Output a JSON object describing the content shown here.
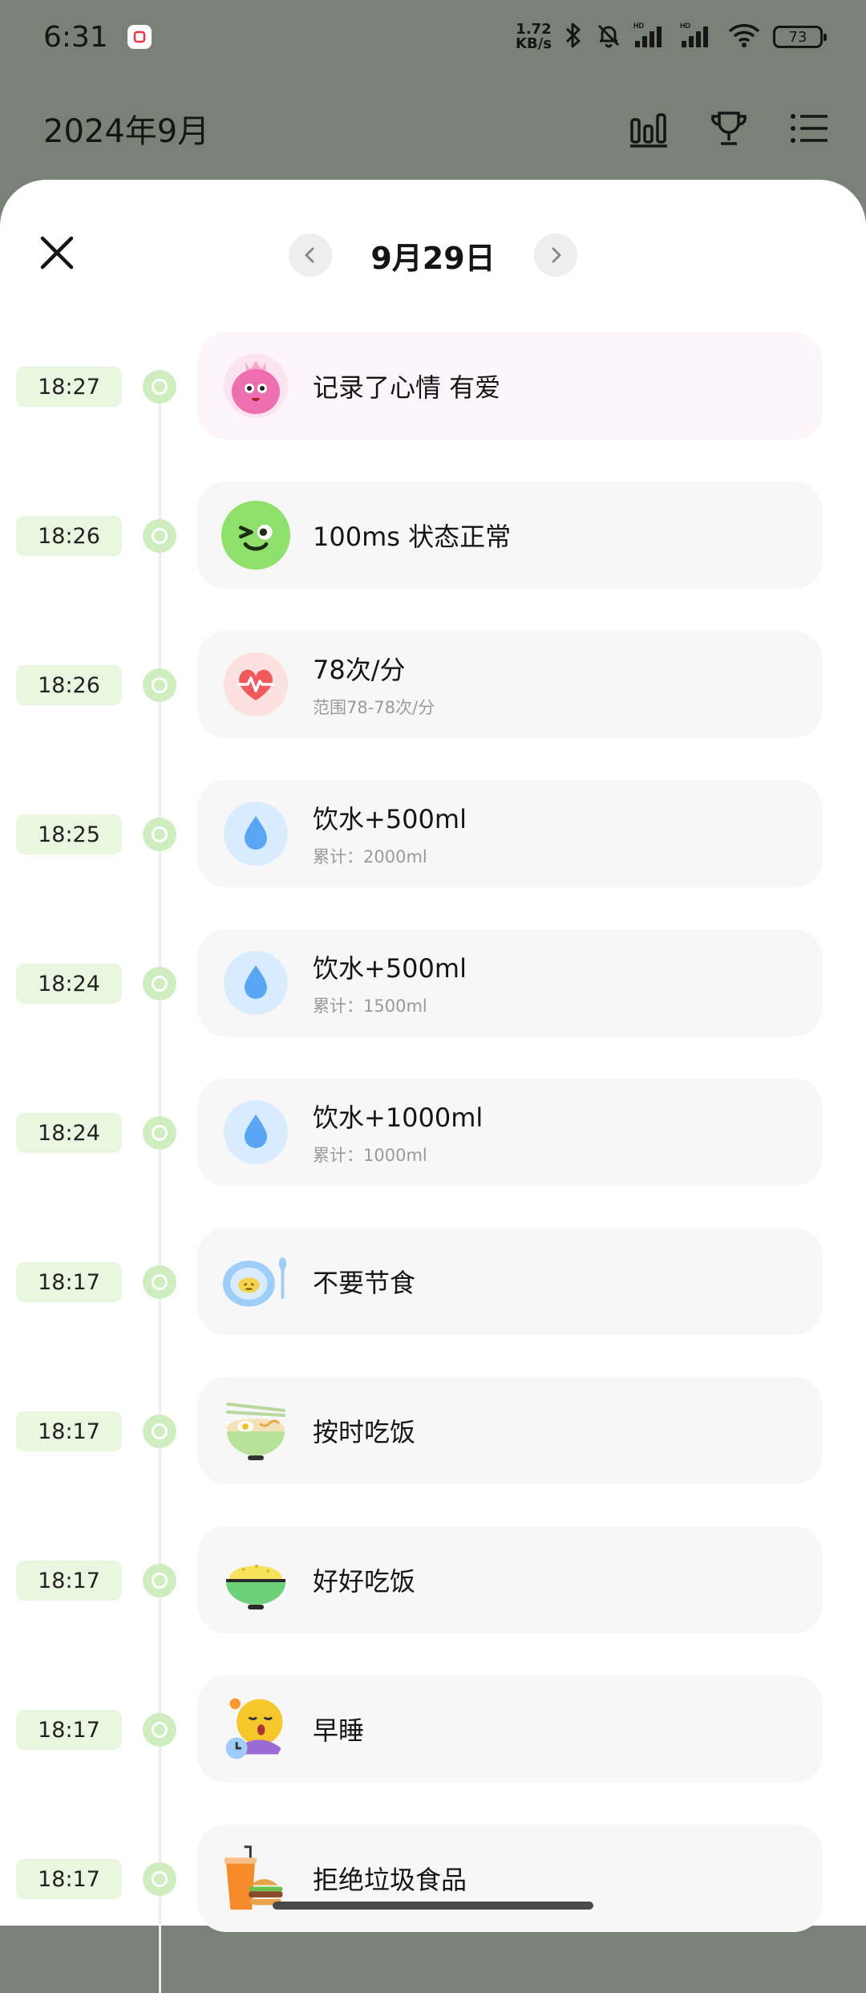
{
  "status_bar": {
    "time": "6:31",
    "net_speed_value": "1.72",
    "net_speed_unit": "KB/s",
    "battery": "73"
  },
  "header": {
    "title": "2024年9月"
  },
  "sheet": {
    "date": "9月29日"
  },
  "entries": [
    {
      "time": "18:27",
      "title": "记录了心情 有爱",
      "sub": "",
      "icon": "love-mood-icon"
    },
    {
      "time": "18:26",
      "title": "100ms 状态正常",
      "sub": "",
      "icon": "normal-mood-icon"
    },
    {
      "time": "18:26",
      "title": "78次/分",
      "sub": "范围78-78次/分",
      "icon": "heart-rate-icon"
    },
    {
      "time": "18:25",
      "title": "饮水+500ml",
      "sub": "累计：2000ml",
      "icon": "water-drop-icon"
    },
    {
      "time": "18:24",
      "title": "饮水+500ml",
      "sub": "累计：1500ml",
      "icon": "water-drop-icon"
    },
    {
      "time": "18:24",
      "title": "饮水+1000ml",
      "sub": "累计：1000ml",
      "icon": "water-drop-icon"
    },
    {
      "time": "18:17",
      "title": "不要节食",
      "sub": "",
      "icon": "plate-spoon-icon"
    },
    {
      "time": "18:17",
      "title": "按时吃饭",
      "sub": "",
      "icon": "noodle-bowl-icon"
    },
    {
      "time": "18:17",
      "title": "好好吃饭",
      "sub": "",
      "icon": "rice-bowl-icon"
    },
    {
      "time": "18:17",
      "title": "早睡",
      "sub": "",
      "icon": "sleepy-face-icon"
    },
    {
      "time": "18:17",
      "title": "拒绝垃圾食品",
      "sub": "",
      "icon": "junk-food-icon"
    }
  ],
  "colors": {
    "time_pill_bg": "#e9f7e0",
    "dot_green": "#cfedbf",
    "card_bg": "#f7f7f7",
    "card_pink_bg": "#fdf5fa",
    "water_blue": "#5aa6f5",
    "heart_red": "#f05a5a",
    "mood_green": "#8ee06a",
    "mood_pink": "#ee6fb0"
  }
}
